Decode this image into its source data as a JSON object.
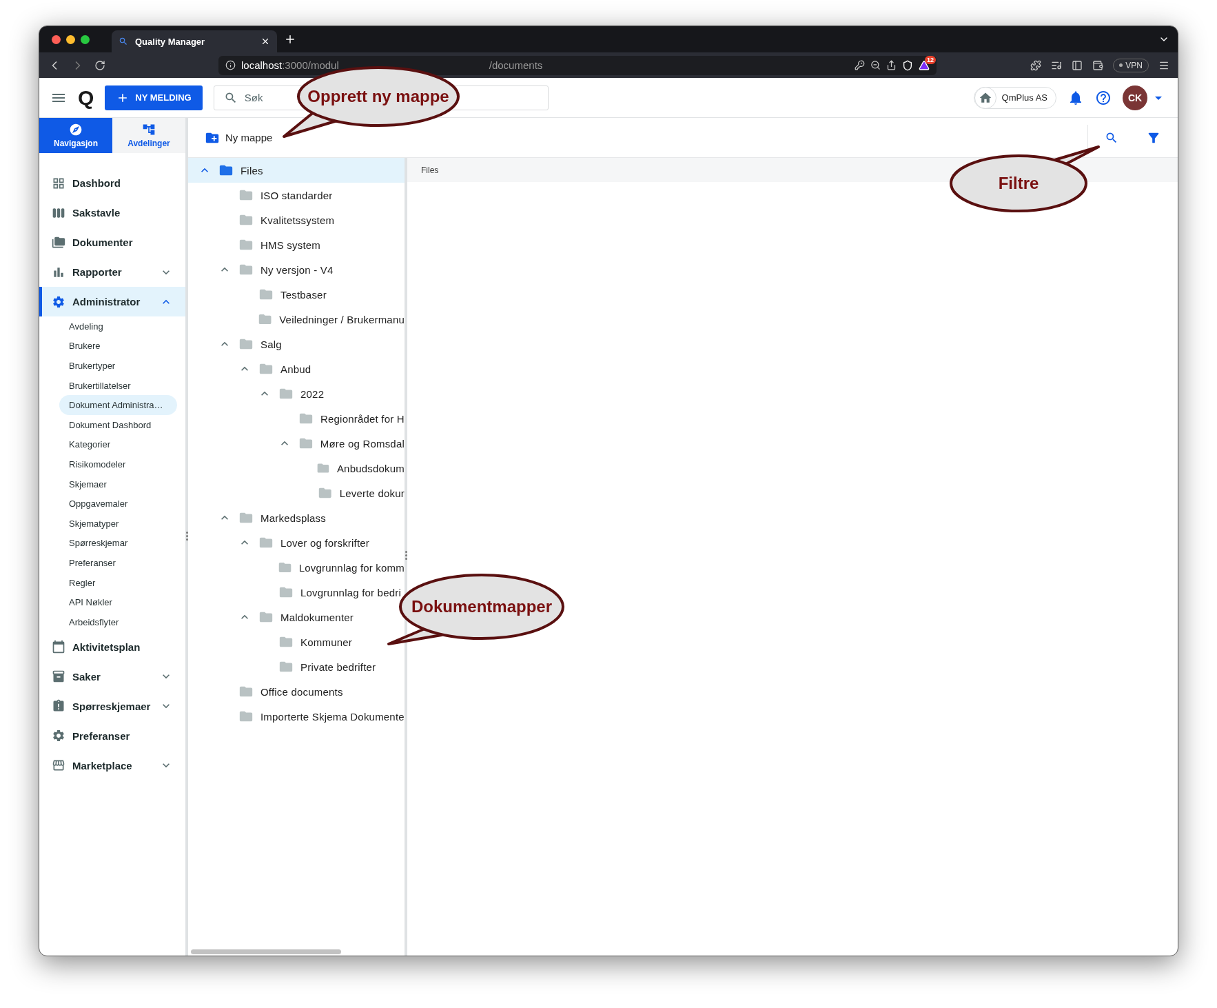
{
  "browser": {
    "tab_title": "Quality Manager",
    "url_host": "localhost",
    "url_path": ":3000/modul",
    "url_tail": "/documents",
    "badge": "12",
    "vpn": "VPN"
  },
  "header": {
    "logo": "Q",
    "new_button": "NY MELDING",
    "search": {
      "placeholder": "Søk"
    },
    "org": "QmPlus AS",
    "avatar": "CK"
  },
  "nav_tabs": [
    {
      "label": "Navigasjon",
      "selected": true
    },
    {
      "label": "Avdelinger",
      "selected": false
    }
  ],
  "sidebar": {
    "items": [
      {
        "label": "Dashbord",
        "selected": false
      },
      {
        "label": "Sakstavle",
        "selected": false
      },
      {
        "label": "Dokumenter",
        "selected": false
      },
      {
        "label": "Rapporter",
        "selected": false,
        "expanded": false
      },
      {
        "label": "Administrator",
        "selected": true,
        "expanded": true,
        "children": [
          {
            "label": "Avdeling",
            "selected": false
          },
          {
            "label": "Brukere",
            "selected": false
          },
          {
            "label": "Brukertyper",
            "selected": false
          },
          {
            "label": "Brukertillatelser",
            "selected": false
          },
          {
            "label": "Dokument Administra…",
            "selected": true
          },
          {
            "label": "Dokument Dashbord",
            "selected": false
          },
          {
            "label": "Kategorier",
            "selected": false
          },
          {
            "label": "Risikomodeler",
            "selected": false
          },
          {
            "label": "Skjemaer",
            "selected": false
          },
          {
            "label": "Oppgavemaler",
            "selected": false
          },
          {
            "label": "Skjematyper",
            "selected": false
          },
          {
            "label": "Spørreskjemar",
            "selected": false
          },
          {
            "label": "Preferanser",
            "selected": false
          },
          {
            "label": "Regler",
            "selected": false
          },
          {
            "label": "API Nøkler",
            "selected": false
          },
          {
            "label": "Arbeidsflyter",
            "selected": false
          }
        ]
      },
      {
        "label": "Aktivitetsplan",
        "selected": false
      },
      {
        "label": "Saker",
        "selected": false,
        "expanded": false
      },
      {
        "label": "Spørreskjemaer",
        "selected": false,
        "expanded": false
      },
      {
        "label": "Preferanser",
        "selected": false
      },
      {
        "label": "Marketplace",
        "selected": false,
        "expanded": false
      }
    ]
  },
  "toolbar": {
    "new_folder": "Ny mappe"
  },
  "tree": [
    {
      "label": "Files",
      "selected": true,
      "expanded": true,
      "children": [
        {
          "label": "ISO standarder",
          "selected": false
        },
        {
          "label": "Kvalitetssystem",
          "selected": false
        },
        {
          "label": "HMS system",
          "selected": false
        },
        {
          "label": "Ny versjon - V4",
          "selected": false,
          "expanded": true,
          "children": [
            {
              "label": "Testbaser",
              "selected": false
            },
            {
              "label": "Veiledninger / Brukermanu",
              "selected": false
            }
          ]
        },
        {
          "label": "Salg",
          "selected": false,
          "expanded": true,
          "children": [
            {
              "label": "Anbud",
              "selected": false,
              "expanded": true,
              "children": [
                {
                  "label": "2022",
                  "selected": false,
                  "expanded": true,
                  "children": [
                    {
                      "label": "Regionrådet for H",
                      "selected": false
                    },
                    {
                      "label": "Møre og Romsdal",
                      "selected": false,
                      "expanded": true,
                      "children": [
                        {
                          "label": "Anbudsdokum",
                          "selected": false
                        },
                        {
                          "label": "Leverte dokur",
                          "selected": false
                        }
                      ]
                    }
                  ]
                }
              ]
            }
          ]
        },
        {
          "label": "Markedsplass",
          "selected": false,
          "expanded": true,
          "children": [
            {
              "label": "Lover og forskrifter",
              "selected": false,
              "expanded": true,
              "children": [
                {
                  "label": "Lovgrunnlag for komm",
                  "selected": false
                },
                {
                  "label": "Lovgrunnlag for bedri",
                  "selected": false
                }
              ]
            },
            {
              "label": "Maldokumenter",
              "selected": false,
              "expanded": true,
              "children": [
                {
                  "label": "Kommuner",
                  "selected": false
                },
                {
                  "label": "Private bedrifter",
                  "selected": false
                }
              ]
            }
          ]
        },
        {
          "label": "Office documents",
          "selected": false
        },
        {
          "label": "Importerte Skjema Dokumente",
          "selected": false
        }
      ]
    }
  ],
  "content": {
    "breadcrumb": "Files"
  },
  "callouts": [
    {
      "text": "Opprett ny mappe"
    },
    {
      "text": "Filtre"
    },
    {
      "text": "Dokumentmapper"
    }
  ]
}
